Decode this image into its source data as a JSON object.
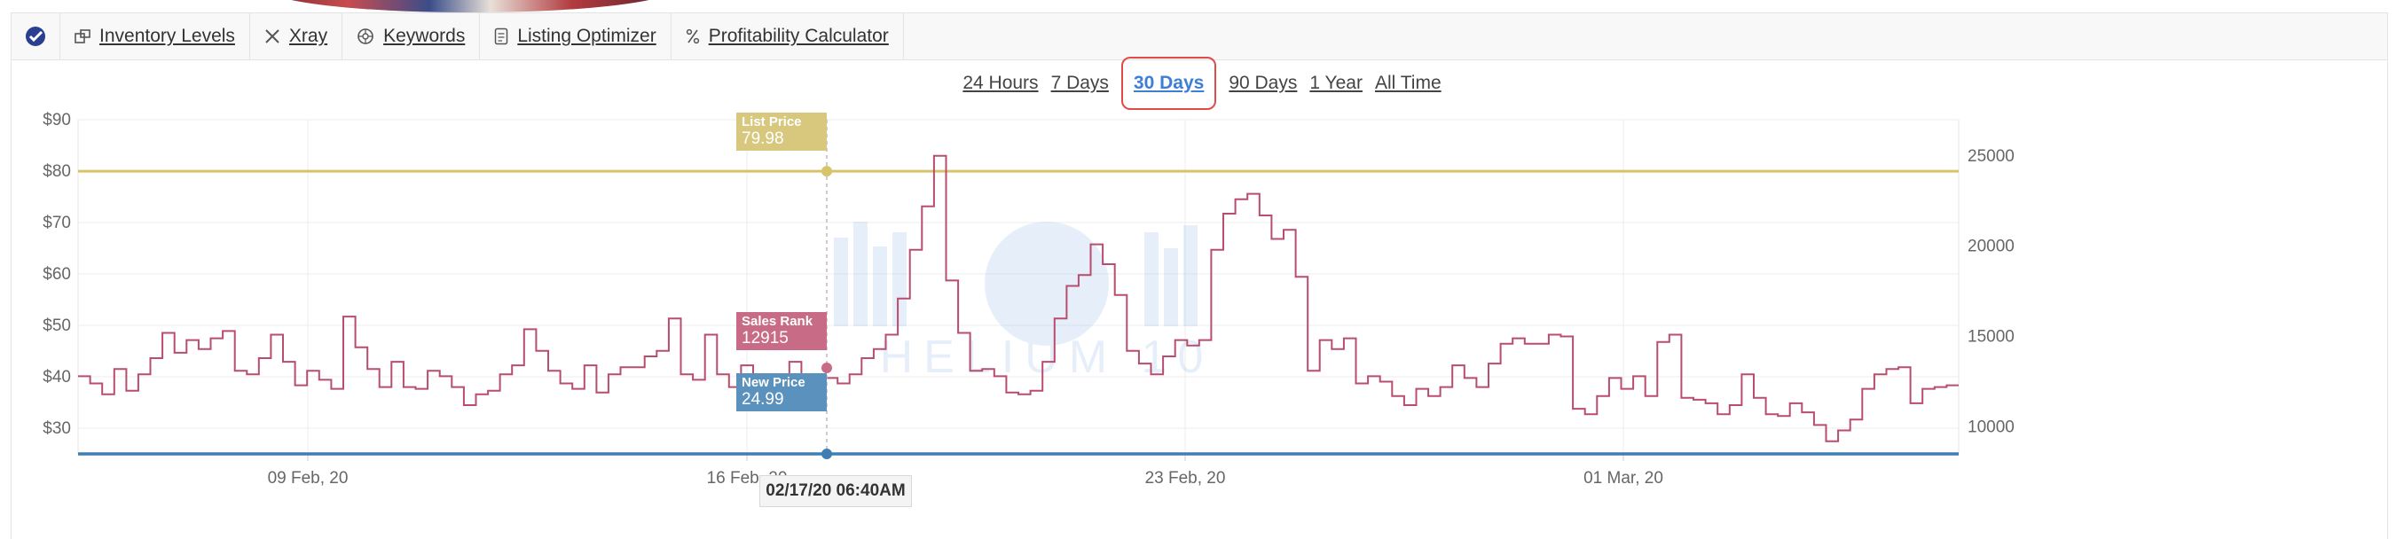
{
  "toolbar": {
    "items": [
      {
        "label": "Inventory Levels",
        "icon": "inventory-icon"
      },
      {
        "label": "Xray",
        "icon": "xray-icon"
      },
      {
        "label": "Keywords",
        "icon": "keywords-icon"
      },
      {
        "label": "Listing Optimizer",
        "icon": "listing-optimizer-icon"
      },
      {
        "label": "Profitability Calculator",
        "icon": "percent-icon"
      }
    ]
  },
  "range": {
    "options": [
      "24 Hours",
      "7 Days",
      "30 Days",
      "90 Days",
      "1 Year",
      "All Time"
    ],
    "selected": "30 Days"
  },
  "chart": {
    "left_axis_labels": [
      "$90",
      "$80",
      "$70",
      "$60",
      "$50",
      "$40",
      "$30"
    ],
    "right_axis_labels": [
      "25000",
      "20000",
      "15000",
      "10000"
    ],
    "x_labels": [
      "09 Feb, 20",
      "16 Feb, 20",
      "23 Feb, 20",
      "01 Mar, 20"
    ],
    "watermark": "HELIUM 10",
    "list_price": {
      "title": "List Price",
      "value": "79.98",
      "color": "#d7c36a"
    },
    "sales_rank": {
      "title": "Sales Rank",
      "value": "12915",
      "color": "#b84d6e"
    },
    "new_price": {
      "title": "New Price",
      "value": "24.99",
      "color": "#3f7db3"
    },
    "hover_date": "02/17/20 06:40AM"
  },
  "chart_data": {
    "type": "line",
    "x_labels": [
      "09 Feb, 20",
      "16 Feb, 20",
      "23 Feb, 20",
      "01 Mar, 20"
    ],
    "y_left_range": [
      25,
      90
    ],
    "y_right_range": [
      8500,
      27000
    ],
    "series": [
      {
        "name": "List Price",
        "axis": "left",
        "constant": 79.98
      },
      {
        "name": "New Price",
        "axis": "left",
        "constant": 24.99
      },
      {
        "name": "Sales Rank",
        "axis": "right",
        "step": true,
        "values": [
          12800,
          12400,
          11800,
          13200,
          12000,
          12900,
          13800,
          15200,
          14100,
          14800,
          14300,
          14900,
          15300,
          13100,
          12900,
          13800,
          15100,
          13600,
          12300,
          13100,
          12600,
          12100,
          16100,
          14400,
          13200,
          12200,
          13600,
          12200,
          12100,
          13100,
          12800,
          12200,
          11200,
          11800,
          12000,
          12900,
          13400,
          15400,
          14200,
          13100,
          12400,
          12100,
          13400,
          11900,
          12900,
          13300,
          13300,
          13900,
          14200,
          16000,
          12900,
          12600,
          15100,
          12900,
          12200,
          13400,
          11900,
          12200,
          12900,
          13600,
          12300,
          12100,
          12700,
          12400,
          12900,
          13800,
          14300,
          15100,
          17100,
          19800,
          22200,
          25000,
          18100,
          15200,
          13100,
          13200,
          12800,
          11900,
          11800,
          12000,
          13600,
          16000,
          17800,
          18400,
          20100,
          19000,
          17300,
          14200,
          13500,
          12900,
          13900,
          14800,
          14500,
          14800,
          19800,
          21800,
          22600,
          22900,
          21700,
          20400,
          20900,
          18300,
          13100,
          14800,
          14300,
          14900,
          12400,
          12800,
          12500,
          11700,
          11200,
          12100,
          11700,
          12200,
          13400,
          12700,
          12200,
          13500,
          14600,
          14900,
          14600,
          14600,
          15100,
          15000,
          11000,
          10700,
          11700,
          12700,
          12100,
          12800,
          11700,
          14700,
          15100,
          11600,
          11500,
          11300,
          10700,
          11200,
          12900,
          11600,
          10700,
          10600,
          11300,
          10800,
          10100,
          9200,
          9800,
          10400,
          12100,
          12900,
          13200,
          13300,
          11300,
          12100,
          12200,
          12300
        ]
      }
    ]
  }
}
